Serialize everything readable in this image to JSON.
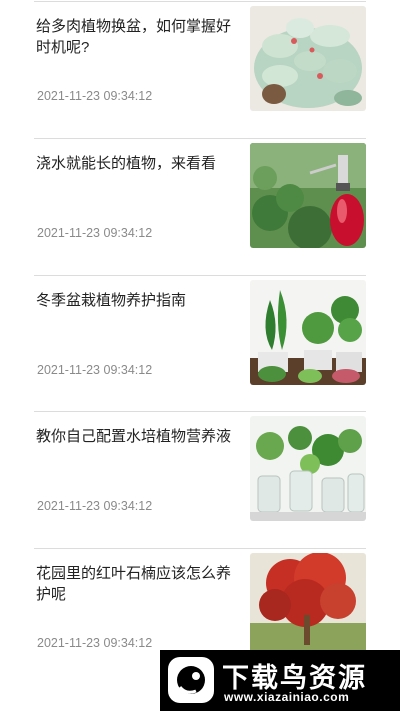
{
  "articles": [
    {
      "title": "给多肉植物换盆，如何掌握好时机呢?",
      "time": "2021-11-23 09:34:12",
      "image": "succulent-photo"
    },
    {
      "title": "浇水就能长的植物，来看看",
      "time": "2021-11-23 09:34:12",
      "image": "watering-plant-photo"
    },
    {
      "title": "冬季盆栽植物养护指南",
      "time": "2021-11-23 09:34:12",
      "image": "potted-plants-photo"
    },
    {
      "title": "教你自己配置水培植物营养液",
      "time": "2021-11-23 09:34:12",
      "image": "hydroponic-plants-photo"
    },
    {
      "title": "花园里的红叶石楠应该怎么养护呢",
      "time": "2021-11-23 09:34:12",
      "image": "red-tree-photo"
    }
  ],
  "watermark": {
    "name": "下载鸟资源",
    "url": "www.xiazainiao.com"
  }
}
